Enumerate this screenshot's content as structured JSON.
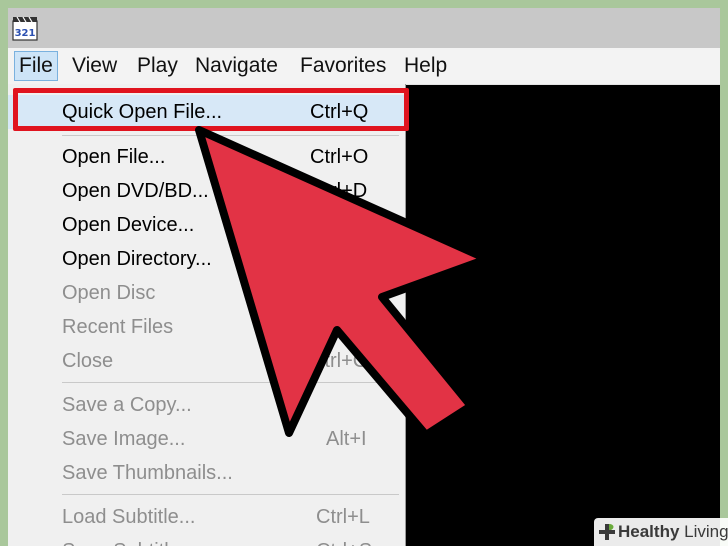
{
  "app": {
    "icon": "media-player-classic-icon"
  },
  "menubar": {
    "items": [
      {
        "label": "File",
        "active": true
      },
      {
        "label": "View"
      },
      {
        "label": "Play"
      },
      {
        "label": "Navigate"
      },
      {
        "label": "Favorites"
      },
      {
        "label": "Help"
      }
    ]
  },
  "file_menu": {
    "items": [
      {
        "label": "Quick Open File...",
        "shortcut": "Ctrl+Q",
        "enabled": true,
        "highlighted": true
      },
      {
        "label": "Open File...",
        "shortcut": "Ctrl+O",
        "enabled": true
      },
      {
        "label": "Open DVD/BD...",
        "shortcut": "Ctrl+D",
        "enabled": true
      },
      {
        "label": "Open Device...",
        "shortcut": "",
        "enabled": true
      },
      {
        "label": "Open Directory...",
        "shortcut": "",
        "enabled": true
      },
      {
        "label": "Open Disc",
        "shortcut": "",
        "enabled": false
      },
      {
        "label": "Recent Files",
        "shortcut": "",
        "enabled": false
      },
      {
        "label": "Close",
        "shortcut": "Ctrl+C",
        "enabled": false
      },
      {
        "label": "Save a Copy...",
        "shortcut": "",
        "enabled": false
      },
      {
        "label": "Save Image...",
        "shortcut": "Alt+I",
        "enabled": false
      },
      {
        "label": "Save Thumbnails...",
        "shortcut": "",
        "enabled": false
      },
      {
        "label": "Load Subtitle...",
        "shortcut": "Ctrl+L",
        "enabled": false
      },
      {
        "label": "Save Subtitle...",
        "shortcut": "Ctrl+S",
        "enabled": false
      }
    ]
  },
  "annotation": {
    "highlight_color": "#e0141f",
    "arrow_fill": "#e23345",
    "arrow_stroke": "#000000"
  },
  "watermark": {
    "brand_bold": "Healthy",
    "brand_rest": " Living",
    "icon": "plus-leaf-icon"
  },
  "colors": {
    "background_border": "#a9c79b",
    "menu_bg": "#f0f0f0",
    "video_bg": "#000000"
  }
}
